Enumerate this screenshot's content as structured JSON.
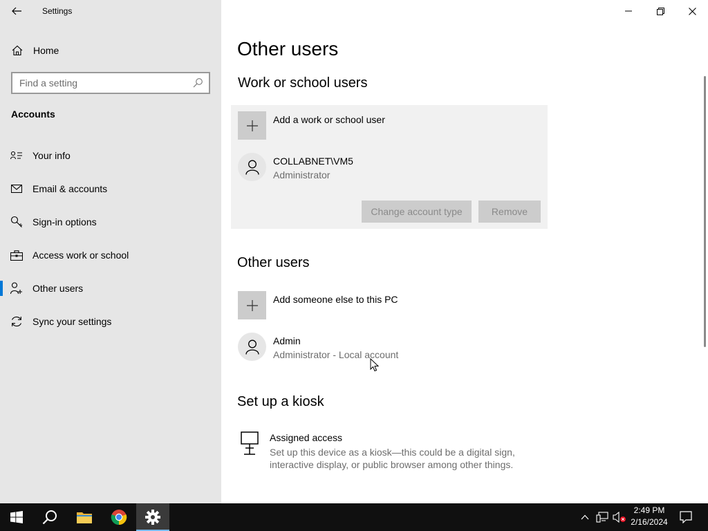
{
  "window": {
    "title": "Settings",
    "controls": {
      "minimize": "minimize-icon",
      "restore": "restore-icon",
      "close": "close-icon"
    }
  },
  "sidebar": {
    "home_label": "Home",
    "search_placeholder": "Find a setting",
    "section_title": "Accounts",
    "items": [
      {
        "label": "Your info",
        "icon": "contact-card-icon"
      },
      {
        "label": "Email & accounts",
        "icon": "mail-icon"
      },
      {
        "label": "Sign-in options",
        "icon": "key-icon"
      },
      {
        "label": "Access work or school",
        "icon": "briefcase-icon"
      },
      {
        "label": "Other users",
        "icon": "person-add-icon",
        "active": true
      },
      {
        "label": "Sync your settings",
        "icon": "sync-icon"
      }
    ]
  },
  "main": {
    "page_title": "Other users",
    "work_school": {
      "heading": "Work or school users",
      "add_label": "Add a work or school user",
      "user": {
        "name": "COLLABNET\\VM5",
        "role": "Administrator"
      },
      "change_type_button": "Change account type",
      "remove_button": "Remove"
    },
    "other_users": {
      "heading": "Other users",
      "add_label": "Add someone else to this PC",
      "user": {
        "name": "Admin",
        "role": "Administrator - Local account"
      }
    },
    "kiosk": {
      "heading": "Set up a kiosk",
      "title": "Assigned access",
      "description": "Set up this device as a kiosk—this could be a digital sign, interactive display, or public browser among other things."
    }
  },
  "taskbar": {
    "apps": [
      "start-icon",
      "search-icon",
      "file-explorer-icon",
      "chrome-icon",
      "settings-icon"
    ],
    "tray": [
      "chevron-up-icon",
      "network-icon",
      "volume-muted-icon"
    ],
    "time": "2:49 PM",
    "date": "2/16/2024"
  },
  "colors": {
    "accent": "#0078d7",
    "sidebar_bg": "#e6e6e6",
    "panel_bg": "#f1f1f1",
    "disabled_btn": "#cccccc",
    "taskbar": "#101010"
  }
}
